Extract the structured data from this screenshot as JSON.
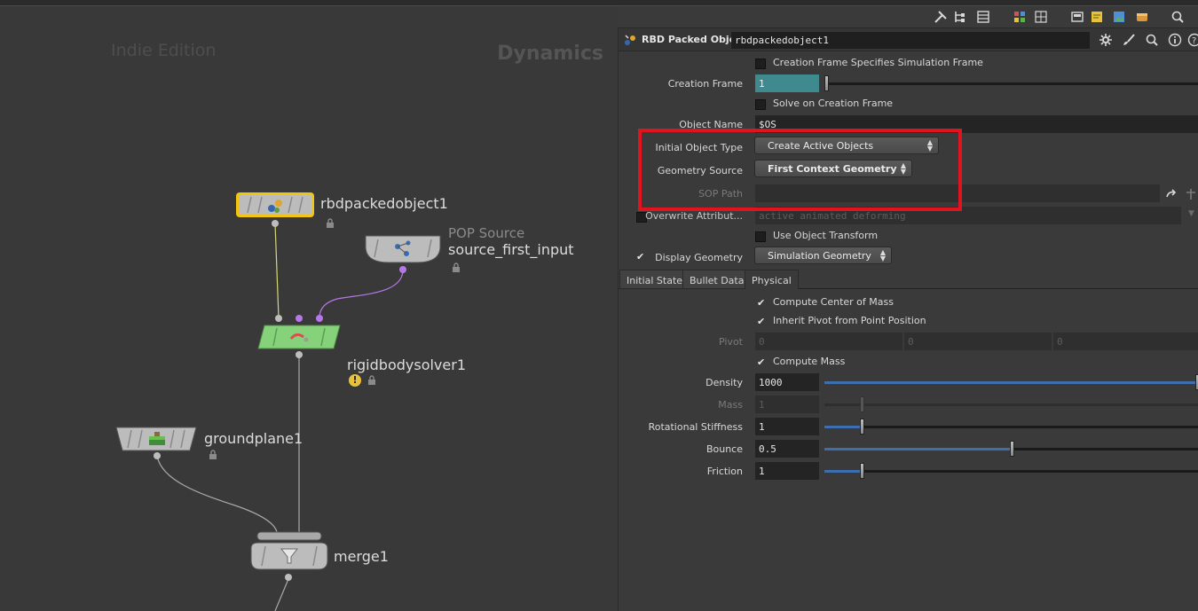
{
  "network": {
    "edition_watermark": "Indie Edition",
    "context_label": "Dynamics",
    "nodes": {
      "rbd": {
        "name": "rbdpackedobject1"
      },
      "pop": {
        "type_label": "POP Source",
        "name": "source_first_input"
      },
      "solver": {
        "name": "rigidbodysolver1"
      },
      "ground": {
        "name": "groundplane1"
      },
      "merge": {
        "name": "merge1"
      }
    }
  },
  "params": {
    "node_type": "RBD Packed Object",
    "node_name": "rbdpackedobject1",
    "creation_frame_specifies_label": "Creation Frame Specifies Simulation Frame",
    "creation_frame": {
      "label": "Creation Frame",
      "value": "1"
    },
    "solve_on_creation_label": "Solve on Creation Frame",
    "object_name": {
      "label": "Object Name",
      "value": "$OS"
    },
    "initial_object_type": {
      "label": "Initial Object Type",
      "value": "Create Active Objects"
    },
    "geometry_source": {
      "label": "Geometry Source",
      "value": "First Context Geometry"
    },
    "sop_path": {
      "label": "SOP Path",
      "value": ""
    },
    "overwrite_attr": {
      "label": "Overwrite Attribut...",
      "value": "active animated deforming"
    },
    "use_object_transform_label": "Use Object Transform",
    "display_geometry": {
      "label": "Display Geometry",
      "value": "Simulation Geometry"
    },
    "tabs": [
      "Initial State",
      "Bullet Data",
      "Physical"
    ],
    "compute_com_label": "Compute Center of Mass",
    "inherit_pivot_label": "Inherit Pivot from Point Position",
    "pivot": {
      "label": "Pivot",
      "x": "0",
      "y": "0",
      "z": "0"
    },
    "compute_mass_label": "Compute Mass",
    "density": {
      "label": "Density",
      "value": "1000"
    },
    "mass": {
      "label": "Mass",
      "value": "1"
    },
    "rot_stiffness": {
      "label": "Rotational Stiffness",
      "value": "1"
    },
    "bounce": {
      "label": "Bounce",
      "value": "0.5"
    },
    "friction": {
      "label": "Friction",
      "value": "1"
    }
  },
  "colors": {
    "highlight": "#e0141f",
    "selected_node": "#f2c511",
    "solver_node": "#86d27a",
    "pop_wire": "#b678e8",
    "slider_fill": "#3d6fb0",
    "frame_field": "#3f8a8f"
  }
}
